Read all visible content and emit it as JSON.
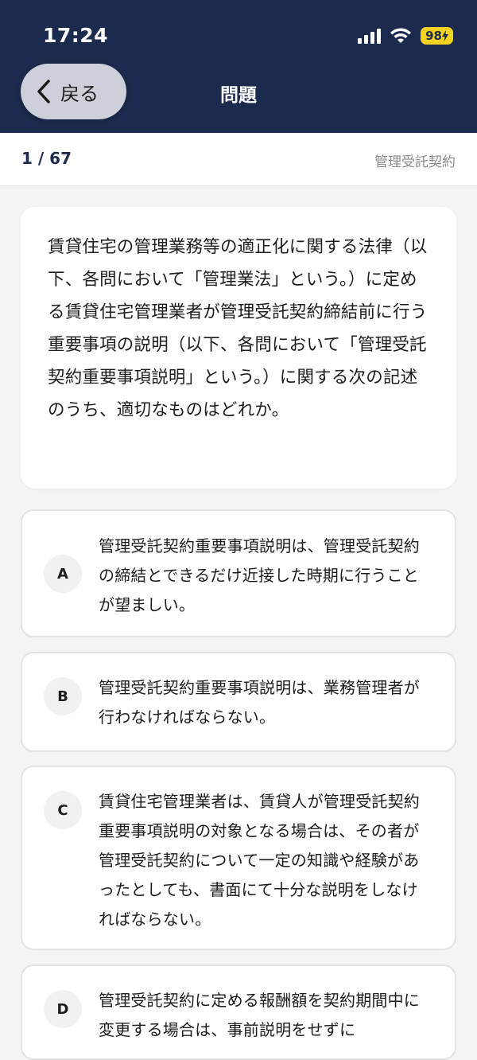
{
  "status_bar": {
    "time": "17:24",
    "battery": "98"
  },
  "header": {
    "back_label": "戻る",
    "title": "問題"
  },
  "progress": {
    "count": "1 / 67",
    "category": "管理受託契約"
  },
  "question": {
    "text": "賃貸住宅の管理業務等の適正化に関する法律（以下、各問において「管理業法」という。）に定める賃貸住宅管理業者が管理受託契約締結前に行う重要事項の説明（以下、各問において「管理受託契約重要事項説明」という。）に関する次の記述のうち、適切なものはどれか。"
  },
  "options": [
    {
      "letter": "A",
      "text": "管理受託契約重要事項説明は、管理受託契約の締結とできるだけ近接した時期に行うことが望ましい。"
    },
    {
      "letter": "B",
      "text": "管理受託契約重要事項説明は、業務管理者が行わなければならない。"
    },
    {
      "letter": "C",
      "text": "賃貸住宅管理業者は、賃貸人が管理受託契約重要事項説明の対象となる場合は、その者が管理受託契約について一定の知識や経験があったとしても、書面にて十分な説明をしなければならない。"
    },
    {
      "letter": "D",
      "text": "管理受託契約に定める報酬額を契約期間中に変更する場合は、事前説明をせずに"
    }
  ],
  "colors": {
    "header_bg": "#1c2b4d",
    "battery": "#f5d21f",
    "page_bg": "#f4f4f6"
  },
  "icons": {
    "back": "chevron-left-icon",
    "signal": "cellular-signal-icon",
    "wifi": "wifi-icon"
  }
}
